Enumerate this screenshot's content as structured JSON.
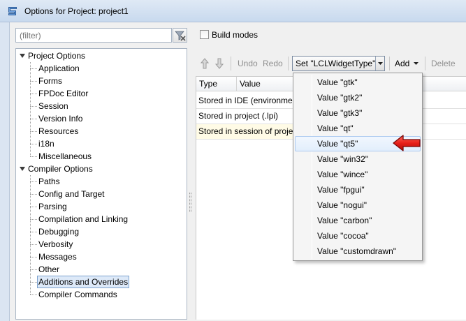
{
  "window": {
    "title": "Options for Project: project1"
  },
  "filter": {
    "placeholder": "(filter)"
  },
  "tree": {
    "project_options": {
      "label": "Project Options",
      "children": [
        "Application",
        "Forms",
        "FPDoc Editor",
        "Session",
        "Version Info",
        "Resources",
        "i18n",
        "Miscellaneous"
      ]
    },
    "compiler_options": {
      "label": "Compiler Options",
      "children": [
        "Paths",
        "Config and Target",
        "Parsing",
        "Compilation and Linking",
        "Debugging",
        "Verbosity",
        "Messages",
        "Other",
        "Additions and Overrides",
        "Compiler Commands"
      ]
    },
    "selected": "Additions and Overrides"
  },
  "build_modes": {
    "label": "Build modes",
    "checked": false
  },
  "toolbar": {
    "undo": "Undo",
    "redo": "Redo",
    "set_label": "Set \"LCLWidgetType\"",
    "add": "Add",
    "delete": "Delete"
  },
  "grid": {
    "columns": [
      "Type",
      "Value"
    ],
    "rows": [
      [
        "Stored in IDE (environment)",
        ""
      ],
      [
        "Stored in project (.lpi)",
        ""
      ],
      [
        "Stored in session of project",
        ""
      ]
    ]
  },
  "dropdown": {
    "items": [
      "Value \"gtk\"",
      "Value \"gtk2\"",
      "Value \"gtk3\"",
      "Value \"qt\"",
      "Value \"qt5\"",
      "Value \"win32\"",
      "Value \"wince\"",
      "Value \"fpgui\"",
      "Value \"nogui\"",
      "Value \"carbon\"",
      "Value \"cocoa\"",
      "Value \"customdrawn\""
    ],
    "highlighted_index": 4
  },
  "colors": {
    "callout_arrow": "#e8201a",
    "selection_border": "#7da2ce"
  }
}
